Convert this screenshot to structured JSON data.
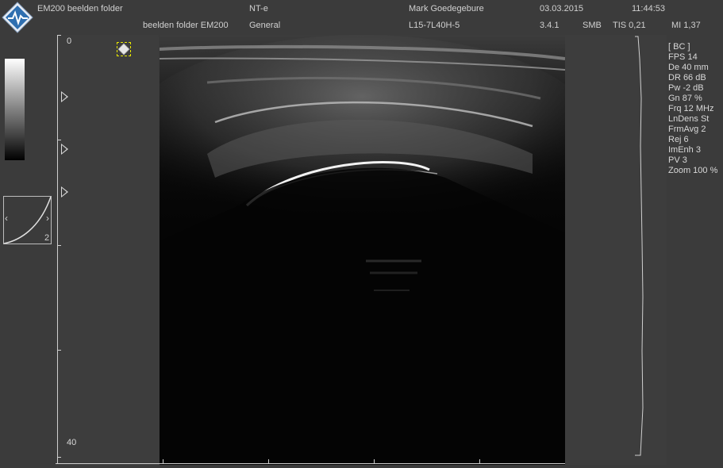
{
  "header": {
    "app_title": "EM200 beelden folder",
    "subtitle": "beelden folder EM200",
    "mode": "NT-e",
    "preset": "General",
    "operator": "Mark Goedegebure",
    "probe": "L15-7L40H-5",
    "date": "03.03.2015",
    "version": "3.4.1",
    "time": "11:44:53",
    "smb": "SMB",
    "tis": "TIS 0,21",
    "mi": "MI 1,37"
  },
  "scale": {
    "depth_top": "0",
    "depth_bottom": "40",
    "curve_number": "2",
    "curve_left_arrow": "‹",
    "curve_right_arrow": "›"
  },
  "params": [
    "[ BC ]",
    "FPS 14",
    "De 40 mm",
    "DR 66 dB",
    "Pw -2 dB",
    "Gn 87 %",
    "Frq 12 MHz",
    "LnDens St",
    "FrmAvg 2",
    "Rej 6",
    "ImEnh 3",
    "PV 3",
    "Zoom 100 %"
  ],
  "colors": {
    "background": "#3b3b3b",
    "image_background": "#050505",
    "text": "#d6d6d6",
    "logo_blue": "#2f6fb0",
    "indicator_yellow": "#e8e800"
  }
}
